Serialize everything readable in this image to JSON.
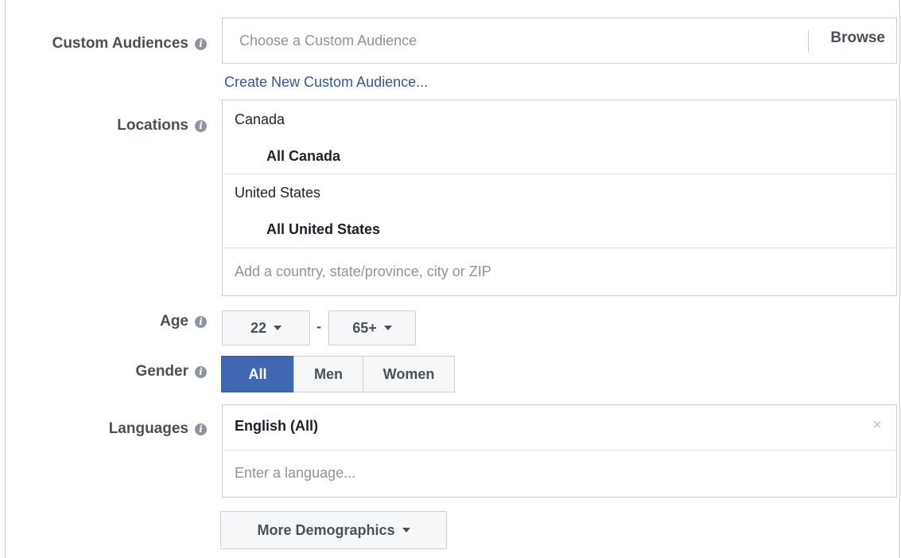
{
  "custom_audiences": {
    "label": "Custom Audiences",
    "placeholder": "Choose a Custom Audience",
    "browse_label": "Browse",
    "create_link": "Create New Custom Audience..."
  },
  "locations": {
    "label": "Locations",
    "entries": [
      {
        "country": "Canada",
        "region": "All Canada"
      },
      {
        "country": "United States",
        "region": "All United States"
      }
    ],
    "placeholder": "Add a country, state/province, city or ZIP"
  },
  "age": {
    "label": "Age",
    "min": "22",
    "separator": "-",
    "max": "65+"
  },
  "gender": {
    "label": "Gender",
    "options": [
      "All",
      "Men",
      "Women"
    ],
    "selected": "All"
  },
  "languages": {
    "label": "Languages",
    "selected": "English (All)",
    "remove_symbol": "×",
    "placeholder": "Enter a language..."
  },
  "more_demographics": {
    "label": "More Demographics"
  },
  "icons": {
    "info": "info-icon",
    "caret": "caret-down-icon",
    "remove": "close-icon"
  },
  "colors": {
    "accent": "#4267b2",
    "link": "#365899",
    "border": "#c9cdd2",
    "label_text": "#4b4f56"
  }
}
